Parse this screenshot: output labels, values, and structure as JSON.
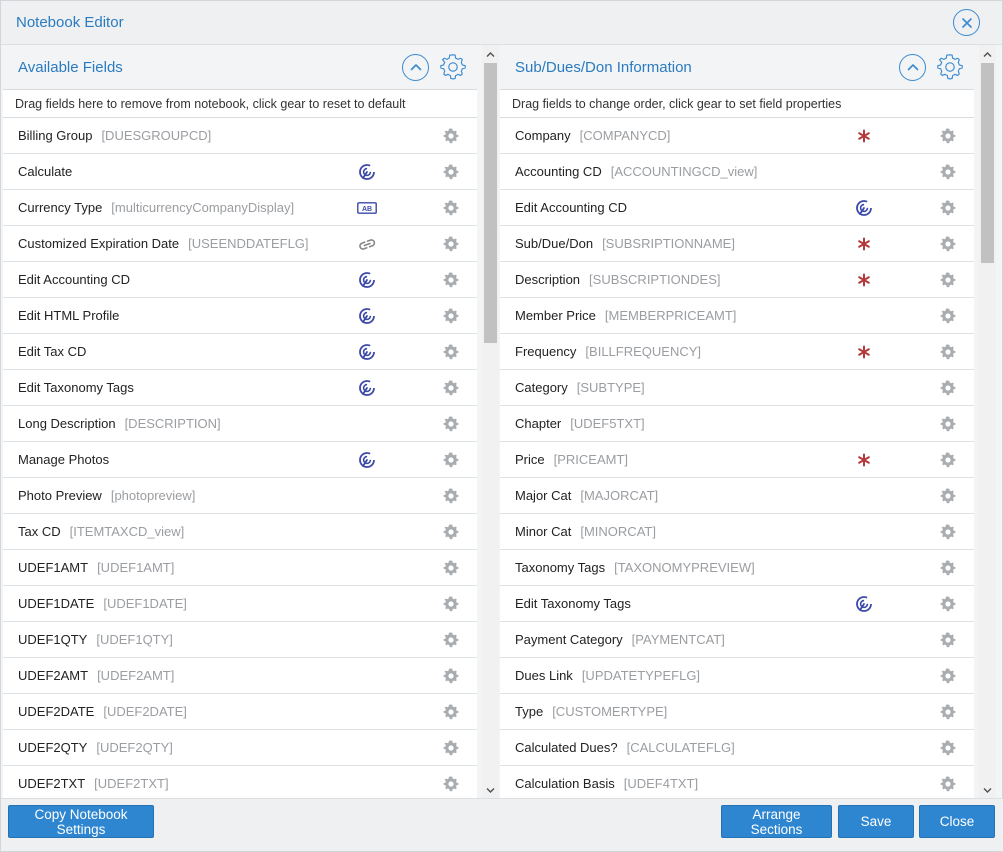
{
  "dialog": {
    "title": "Notebook Editor"
  },
  "left_panel": {
    "title": "Available Fields",
    "hint": "Drag fields here to remove from notebook, click gear to reset to default",
    "rows": [
      {
        "label": "Billing Group",
        "code": "[DUESGROUPCD]",
        "icon": "none"
      },
      {
        "label": "Calculate",
        "code": "",
        "icon": "target-icon"
      },
      {
        "label": "Currency Type",
        "code": "[multicurrencyCompanyDisplay]",
        "icon": "ab-field-icon"
      },
      {
        "label": "Customized Expiration Date",
        "code": "[USEENDDATEFLG]",
        "icon": "link-icon"
      },
      {
        "label": "Edit Accounting CD",
        "code": "",
        "icon": "target-icon"
      },
      {
        "label": "Edit HTML Profile",
        "code": "",
        "icon": "target-icon"
      },
      {
        "label": "Edit Tax CD",
        "code": "",
        "icon": "target-icon"
      },
      {
        "label": "Edit Taxonomy Tags",
        "code": "",
        "icon": "target-icon"
      },
      {
        "label": "Long Description",
        "code": "[DESCRIPTION]",
        "icon": "none"
      },
      {
        "label": "Manage Photos",
        "code": "",
        "icon": "target-icon"
      },
      {
        "label": "Photo Preview",
        "code": "[photopreview]",
        "icon": "none"
      },
      {
        "label": "Tax CD",
        "code": "[ITEMTAXCD_view]",
        "icon": "none"
      },
      {
        "label": "UDEF1AMT",
        "code": "[UDEF1AMT]",
        "icon": "none"
      },
      {
        "label": "UDEF1DATE",
        "code": "[UDEF1DATE]",
        "icon": "none"
      },
      {
        "label": "UDEF1QTY",
        "code": "[UDEF1QTY]",
        "icon": "none"
      },
      {
        "label": "UDEF2AMT",
        "code": "[UDEF2AMT]",
        "icon": "none"
      },
      {
        "label": "UDEF2DATE",
        "code": "[UDEF2DATE]",
        "icon": "none"
      },
      {
        "label": "UDEF2QTY",
        "code": "[UDEF2QTY]",
        "icon": "none"
      },
      {
        "label": "UDEF2TXT",
        "code": "[UDEF2TXT]",
        "icon": "none"
      },
      {
        "label": "",
        "code": "",
        "icon": "none"
      }
    ]
  },
  "right_panel": {
    "title": "Sub/Dues/Don Information",
    "hint": "Drag fields to change order, click gear to set field properties",
    "rows": [
      {
        "label": "Company",
        "code": "[COMPANYCD]",
        "icon": "required-asterisk-icon"
      },
      {
        "label": "Accounting CD",
        "code": "[ACCOUNTINGCD_view]",
        "icon": "none"
      },
      {
        "label": "Edit Accounting CD",
        "code": "",
        "icon": "target-icon"
      },
      {
        "label": "Sub/Due/Don",
        "code": "[SUBSRIPTIONNAME]",
        "icon": "required-asterisk-icon"
      },
      {
        "label": "Description",
        "code": "[SUBSCRIPTIONDES]",
        "icon": "required-asterisk-icon"
      },
      {
        "label": "Member Price",
        "code": "[MEMBERPRICEAMT]",
        "icon": "none"
      },
      {
        "label": "Frequency",
        "code": "[BILLFREQUENCY]",
        "icon": "required-asterisk-icon"
      },
      {
        "label": "Category",
        "code": "[SUBTYPE]",
        "icon": "none"
      },
      {
        "label": "Chapter",
        "code": "[UDEF5TXT]",
        "icon": "none"
      },
      {
        "label": "Price",
        "code": "[PRICEAMT]",
        "icon": "required-asterisk-icon"
      },
      {
        "label": "Major Cat",
        "code": "[MAJORCAT]",
        "icon": "none"
      },
      {
        "label": "Minor Cat",
        "code": "[MINORCAT]",
        "icon": "none"
      },
      {
        "label": "Taxonomy Tags",
        "code": "[TAXONOMYPREVIEW]",
        "icon": "none"
      },
      {
        "label": "Edit Taxonomy Tags",
        "code": "",
        "icon": "target-icon"
      },
      {
        "label": "Payment Category",
        "code": "[PAYMENTCAT]",
        "icon": "none"
      },
      {
        "label": "Dues Link",
        "code": "[UPDATETYPEFLG]",
        "icon": "none"
      },
      {
        "label": "Type",
        "code": "[CUSTOMERTYPE]",
        "icon": "none"
      },
      {
        "label": "Calculated Dues?",
        "code": "[CALCULATEFLG]",
        "icon": "none"
      },
      {
        "label": "Calculation Basis",
        "code": "[UDEF4TXT]",
        "icon": "none"
      },
      {
        "label": "",
        "code": "",
        "icon": "none"
      }
    ]
  },
  "footer": {
    "copy_settings_label": "Copy Notebook Settings",
    "arrange_sections_label": "Arrange Sections",
    "save_label": "Save",
    "close_label": "Close"
  },
  "colors": {
    "accent": "#2a7bc0",
    "button": "#2e86d0",
    "required": "#b23a3a",
    "target_icon": "#3b4aa8",
    "gear": "#a9acb0"
  }
}
